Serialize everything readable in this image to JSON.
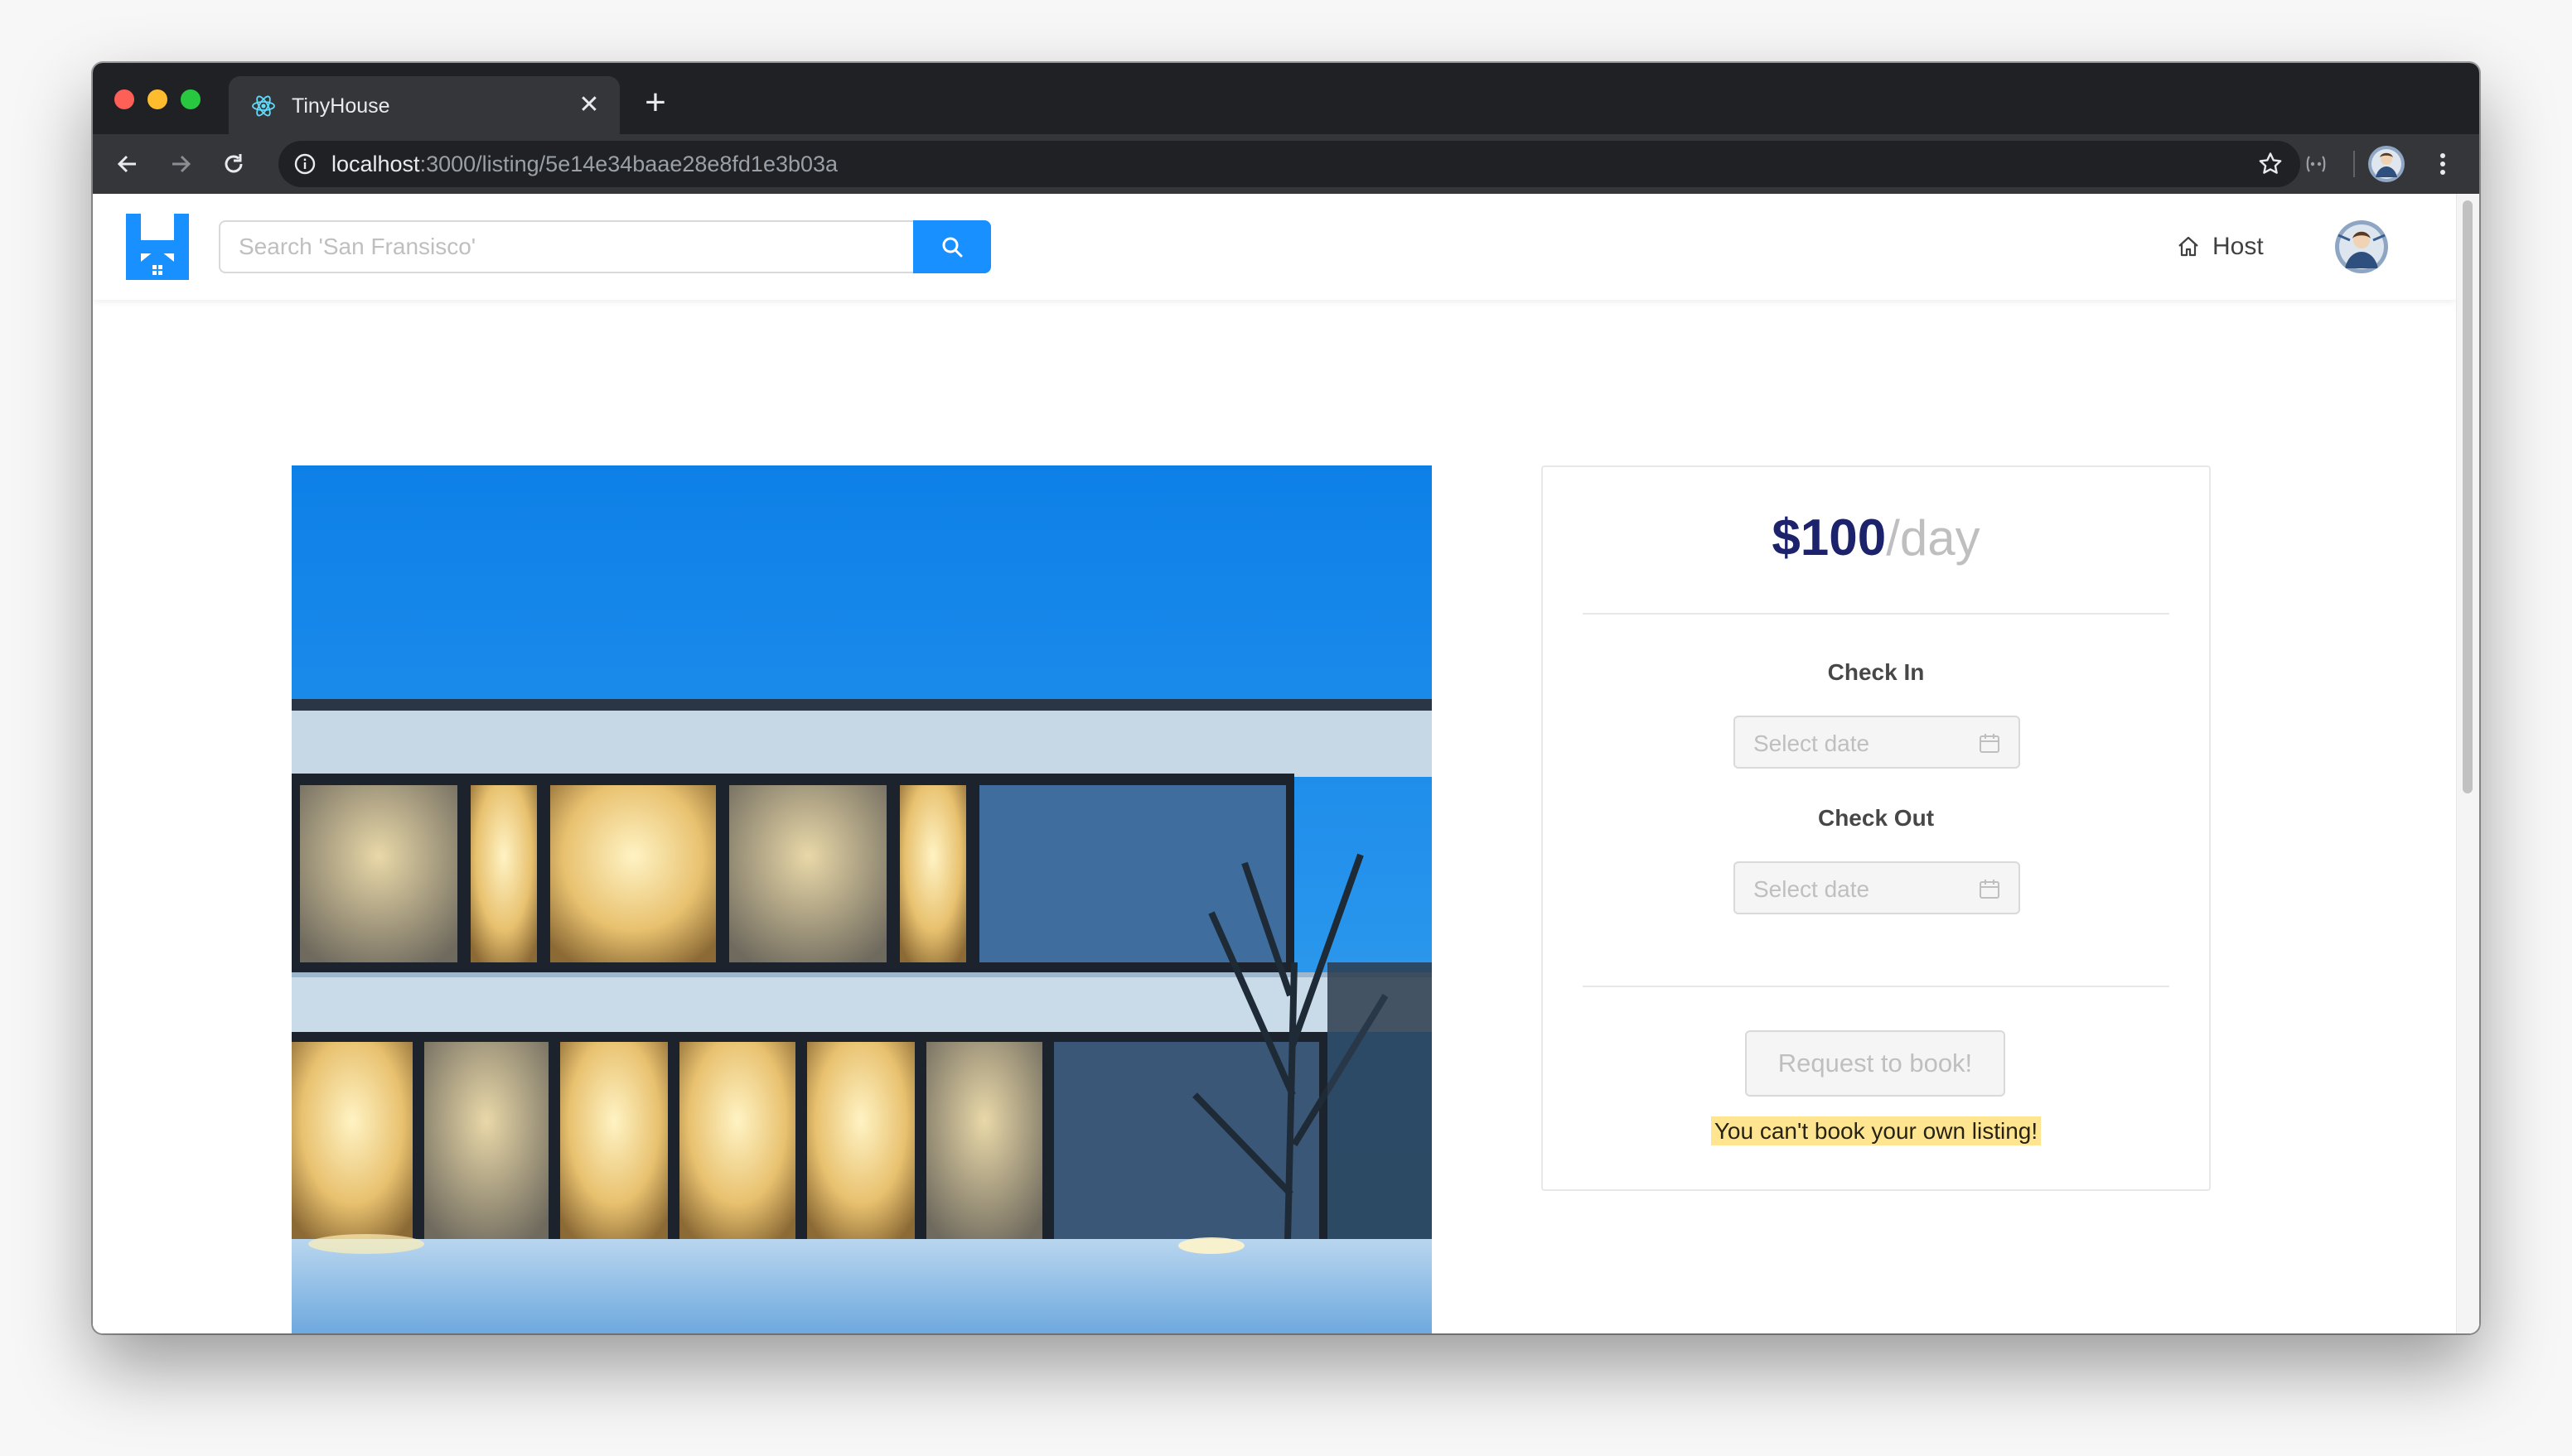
{
  "browser": {
    "tab_title": "TinyHouse",
    "tab_close_glyph": "✕",
    "new_tab_glyph": "+",
    "url_host": "localhost",
    "url_rest": ":3000/listing/5e14e34baae28e8fd1e3b03a",
    "icons": [
      "react-favicon-icon",
      "back-arrow-icon",
      "forward-arrow-icon",
      "reload-icon",
      "info-icon",
      "star-icon",
      "extension-icon",
      "profile-avatar",
      "menu-dots-icon"
    ]
  },
  "header": {
    "search_placeholder": "Search 'San Fransisco'",
    "host_label": "Host",
    "brand_color": "#1890ff"
  },
  "listing": {
    "image_alt": "Listing photo of a modern two-storey house at dusk in the snow"
  },
  "booking": {
    "price_amount": "$100",
    "price_unit": "/day",
    "check_in_label": "Check In",
    "check_in_placeholder": "Select date",
    "check_out_label": "Check Out",
    "check_out_placeholder": "Select date",
    "request_button_label": "Request to book!",
    "own_listing_warning": "You can't book your own listing!",
    "price_color": "#1d226c",
    "warning_highlight_color": "#ffe58f"
  }
}
